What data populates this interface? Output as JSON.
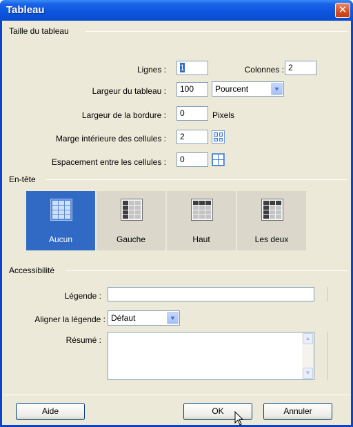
{
  "window": {
    "title": "Tableau",
    "close_glyph": "✕"
  },
  "size_section": {
    "title": "Taille du tableau",
    "rows_label": "Lignes :",
    "rows_value": "1",
    "cols_label": "Colonnes :",
    "cols_value": "2",
    "width_label": "Largeur du tableau :",
    "width_value": "100",
    "width_unit": "Pourcent",
    "border_label": "Largeur de la bordure :",
    "border_value": "0",
    "border_unit": "Pixels",
    "padding_label": "Marge intérieure des cellules :",
    "padding_value": "2",
    "spacing_label": "Espacement entre les cellules :",
    "spacing_value": "0"
  },
  "header_section": {
    "title": "En-tête",
    "options": [
      {
        "label": "Aucun",
        "selected": true
      },
      {
        "label": "Gauche",
        "selected": false
      },
      {
        "label": "Haut",
        "selected": false
      },
      {
        "label": "Les deux",
        "selected": false
      }
    ]
  },
  "accessibility": {
    "title": "Accessibilité",
    "caption_label": "Légende :",
    "caption_value": "",
    "align_label": "Aligner la légende :",
    "align_value": "Défaut",
    "summary_label": "Résumé :",
    "summary_value": ""
  },
  "buttons": {
    "help": "Aide",
    "ok": "OK",
    "cancel": "Annuler"
  },
  "colors": {
    "title_bar": "#0b55de",
    "selection": "#316ac5",
    "dialog_bg": "#ece9d8"
  }
}
